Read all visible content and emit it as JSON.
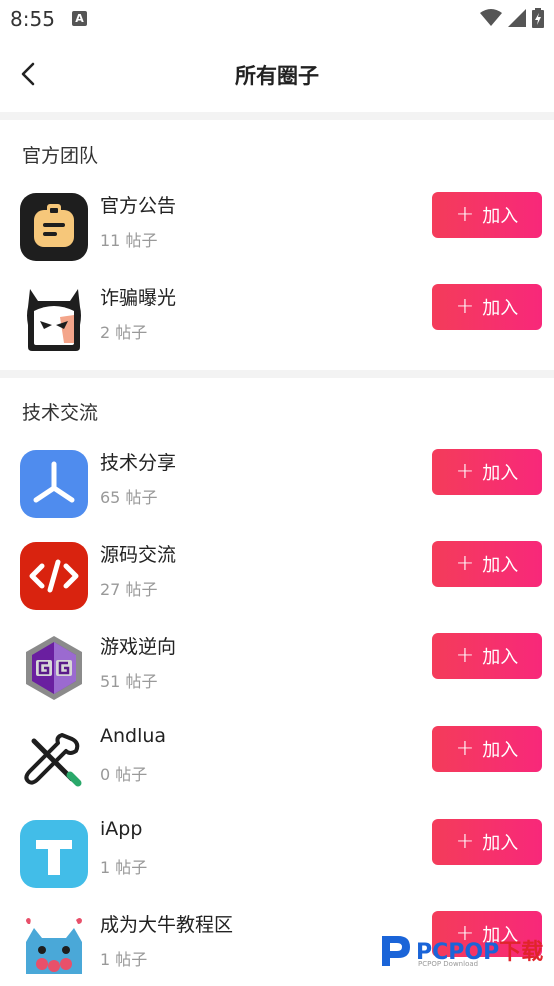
{
  "status": {
    "time": "8:55",
    "a_badge": "A"
  },
  "nav": {
    "title": "所有圈子"
  },
  "sections": [
    {
      "title": "官方团队"
    },
    {
      "title": "技术交流"
    }
  ],
  "join_label": "加入",
  "join_plus": "+",
  "items": [
    {
      "name": "官方公告",
      "count": "11 帖子",
      "icon": "announcement-icon"
    },
    {
      "name": "诈骗曝光",
      "count": "2 帖子",
      "icon": "ghost-icon"
    },
    {
      "name": "技术分享",
      "count": "65 帖子",
      "icon": "share-icon"
    },
    {
      "name": "源码交流",
      "count": "27 帖子",
      "icon": "code-icon"
    },
    {
      "name": "游戏逆向",
      "count": "51 帖子",
      "icon": "gameguardian-icon"
    },
    {
      "name": "Andlua",
      "count": "0 帖子",
      "icon": "tools-icon"
    },
    {
      "name": "iApp",
      "count": "1 帖子",
      "icon": "iapp-icon"
    },
    {
      "name": "成为大牛教程区",
      "count": "1 帖子",
      "icon": "cat-mascot-icon"
    }
  ],
  "watermark": {
    "text_blue": "PCPOP",
    "text_red": "下载",
    "sub": "PCPOP Download"
  },
  "colors": {
    "accent": "#f43c5a",
    "accent_end": "#f8287a"
  }
}
